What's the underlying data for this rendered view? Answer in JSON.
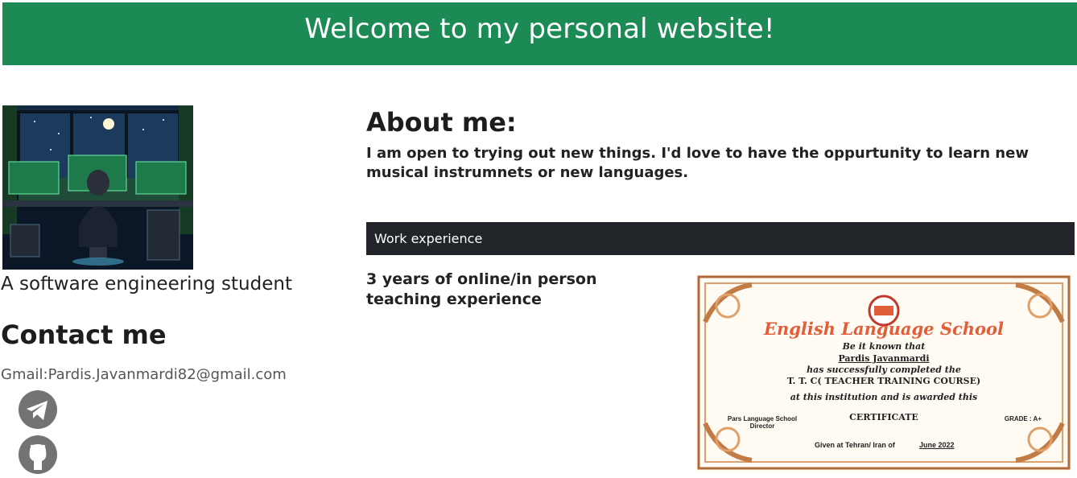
{
  "header": {
    "title": "Welcome to my personal website!"
  },
  "profile": {
    "tagline": "A software engineering student",
    "contact_title": "Contact me",
    "email": "Gmail:Pardis.Javanmardi82@gmail.com",
    "social": [
      {
        "icon": "telegram-icon"
      },
      {
        "icon": "github-icon"
      }
    ]
  },
  "about": {
    "title": "About me:",
    "text": "I am open to trying out new things. I'd love to have the oppurtunity to learn new musical instrumnets or new languages."
  },
  "work": {
    "section_label": "Work experience",
    "experience_text": "3 years of online/in person teaching experience",
    "certificate": {
      "school_badge": "PARS LANGUAGE SCHOOL",
      "title": "English Language School",
      "line1": "Be it known that",
      "name": "Pardis Javanmardi",
      "line2": "has successfully completed the",
      "course": "T. T. C( TEACHER TRAINING COURSE)",
      "line3": "at this institution and is awarded this",
      "award": "CERTIFICATE",
      "grade": "GRADE : A+",
      "director": "Pars Language School Director",
      "given": "Given at Tehran/ Iran of",
      "date": "June 2022"
    }
  },
  "colors": {
    "header_bg": "#1b8a54",
    "section_bar_bg": "#212529",
    "icon_gray": "#737373",
    "cert_accent": "#e05e3a"
  }
}
